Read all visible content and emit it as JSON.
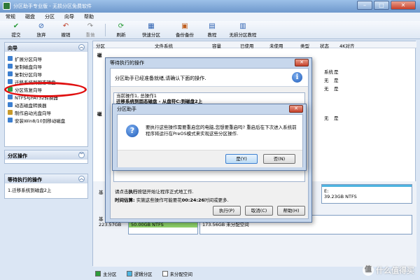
{
  "window": {
    "title": "分区助手专业版 - 无损分区免费软件"
  },
  "menu": [
    "常规",
    "磁盘",
    "分区",
    "向导",
    "帮助"
  ],
  "toolbar": [
    {
      "label": "提交",
      "icon": "✔"
    },
    {
      "label": "放弃",
      "icon": "⊘"
    },
    {
      "label": "撤销",
      "icon": "↶"
    },
    {
      "label": "重做",
      "icon": "↷"
    },
    {
      "label": "刷新",
      "icon": "⟳"
    },
    {
      "label": "快速分区",
      "icon": "▦"
    },
    {
      "label": "备份备份",
      "icon": "▣"
    },
    {
      "label": "教程",
      "icon": "▤"
    },
    {
      "label": "无损分区教程",
      "icon": "▥"
    }
  ],
  "sidebar": {
    "wizard_title": "向导",
    "wizard_items": [
      {
        "label": "扩展分区向导",
        "color": "#3c7fd0"
      },
      {
        "label": "复制磁盘向导",
        "color": "#3c7fd0"
      },
      {
        "label": "复制分区向导",
        "color": "#3c7fd0"
      },
      {
        "label": "迁移系统到固态硬盘",
        "color": "#3c7fd0"
      },
      {
        "label": "分区恢复向导",
        "color": "#2e9c4a"
      },
      {
        "label": "NTFS与FAT32转换器",
        "color": "#3c7fd0"
      },
      {
        "label": "动态磁盘转换器",
        "color": "#3c7fd0"
      },
      {
        "label": "制作启动光盘向导",
        "color": "#c89a2a"
      },
      {
        "label": "安装Win8/10到移动磁盘",
        "color": "#3c7fd0"
      }
    ],
    "partition_ops_title": "分区操作",
    "pending_title": "等待执行的操作",
    "pending_items": [
      "1.迁移系统到磁盘2上"
    ]
  },
  "table": {
    "headers": [
      "分区",
      "文件系统",
      "容量",
      "已使用",
      "未使用",
      "类型",
      "状态",
      "4K对齐"
    ],
    "group1": "磁",
    "rows": [
      {
        "type": "",
        "status": "系统",
        "align": "是"
      },
      {
        "type": "",
        "status": "无",
        "align": "是"
      },
      {
        "type": "",
        "status": "无",
        "align": "是"
      }
    ],
    "group2": "磁",
    "rows2": [
      {
        "type": "",
        "status": "无",
        "align": "是"
      }
    ]
  },
  "disks": {
    "disk1_prefix": "基",
    "disk1_right_label": "E:",
    "disk1_right_info": "39.23GB NTFS",
    "disk2_prefix": "基",
    "disk2_size": "223.57GB",
    "disk2_part1": "*",
    "disk2_part1_info": "50.00GB NTFS",
    "disk2_part2": "*",
    "disk2_part2_info": "173.56GB 未分配空间"
  },
  "legend": [
    {
      "label": "主分区",
      "color": "#2f9c3a"
    },
    {
      "label": "逻辑分区",
      "color": "#4db4e0"
    },
    {
      "label": "未分配空间",
      "color": "#ffffff"
    }
  ],
  "pending_dialog": {
    "title": "等待执行的操作",
    "intro": "分区助手已经准备就绪,请确认下面的操作.",
    "list_line1": "当前操作1, 总操作1",
    "list_line2": "迁移系统到固态磁盘 - 从盘符C:到磁盘2上",
    "note1_prefix": "请点击",
    "note1_bold": "执行",
    "note1_suffix": "按钮开始让程序正式地工作.",
    "time_label": "时间估算:",
    "time_text_prefix": "实施这些操作可能要花",
    "time_value": "00:24:26",
    "time_text_suffix": "时间或更多.",
    "btn_execute": "执行(P)",
    "btn_cancel": "取消(C)",
    "btn_help": "帮助(H)"
  },
  "confirm_dialog": {
    "title": "分区助手",
    "message": "要执行这些操作需要重启您的电脑,您想要重启吗? 重启后在下次进入系统前程序将运行在PreOS模式来实现这些分区操作.",
    "btn_yes": "是(Y)",
    "btn_no": "否(N)"
  },
  "watermark": {
    "badge": "值",
    "text": "什么值得买"
  }
}
